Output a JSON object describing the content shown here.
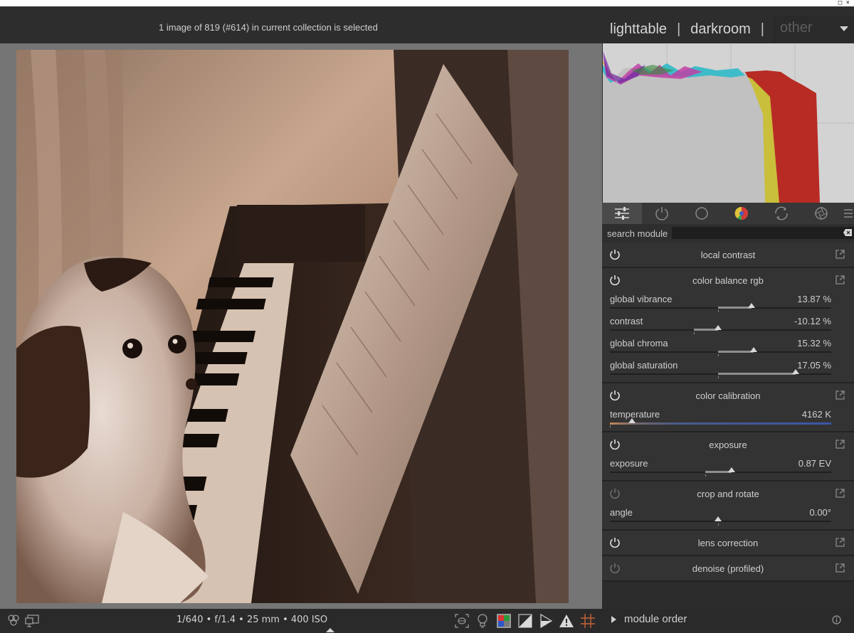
{
  "header": {
    "status": "1 image of 819 (#614) in current collection is selected",
    "views": [
      "lighttable",
      "darkroom"
    ],
    "separator": "|",
    "view_other": "other"
  },
  "top_strip": {
    "mini": "□   ×"
  },
  "histogram": {
    "colors": {
      "background": "#d3d3d3",
      "red": "#b82b25",
      "yellow": "#c9bf3b",
      "cyan": "#3fbcc9",
      "magenta": "#c13fa6",
      "gray": "#c1c1c1"
    }
  },
  "module_tabs": [
    {
      "icon": "sliders-icon",
      "active": true
    },
    {
      "icon": "power-icon"
    },
    {
      "icon": "circle-icon"
    },
    {
      "icon": "color-wheel-icon"
    },
    {
      "icon": "effects-icon"
    },
    {
      "icon": "aperture-icon"
    },
    {
      "icon": "menu-icon"
    }
  ],
  "search": {
    "label": "search module",
    "value": ""
  },
  "modules": [
    {
      "title": "local contrast",
      "enabled": true,
      "sliders": []
    },
    {
      "title": "color balance rgb",
      "enabled": true,
      "sliders": [
        {
          "label": "global vibrance",
          "value": "13.87 %",
          "fill_from": 0.49,
          "fill_to": 0.64
        },
        {
          "label": "contrast",
          "value": "-10.12 %",
          "fill_from": 0.38,
          "fill_to": 0.49
        },
        {
          "label": "global chroma",
          "value": "15.32 %",
          "fill_from": 0.49,
          "fill_to": 0.65
        },
        {
          "label": "global saturation",
          "value": "17.05 %",
          "fill_from": 0.49,
          "fill_to": 0.84
        }
      ]
    },
    {
      "title": "color calibration",
      "enabled": true,
      "sliders": [
        {
          "label": "temperature",
          "value": "4162 K",
          "fill_from": 0.0,
          "fill_to": 0.1,
          "gradient": true
        }
      ]
    },
    {
      "title": "exposure",
      "enabled": true,
      "sliders": [
        {
          "label": "exposure",
          "value": "0.87 EV",
          "fill_from": 0.43,
          "fill_to": 0.55
        }
      ]
    },
    {
      "title": "crop and rotate",
      "enabled": false,
      "sliders": [
        {
          "label": "angle",
          "value": "0.00°",
          "fill_from": 0.49,
          "fill_to": 0.49
        }
      ]
    },
    {
      "title": "lens correction",
      "enabled": true,
      "sliders": []
    },
    {
      "title": "denoise (profiled)",
      "enabled": false,
      "sliders": []
    }
  ],
  "module_order": {
    "label": "module order"
  },
  "bottom": {
    "exif": "1/640 • f/1.4 • 25 mm • 400 ISO",
    "left_icons": [
      "styles-icon",
      "display-icon"
    ],
    "right_icons": [
      "focus-peaking-icon",
      "bulb-icon",
      "color-assessment-icon",
      "soft-proof-icon",
      "gamut-check-icon",
      "warning-icon",
      "guides-icon"
    ]
  }
}
